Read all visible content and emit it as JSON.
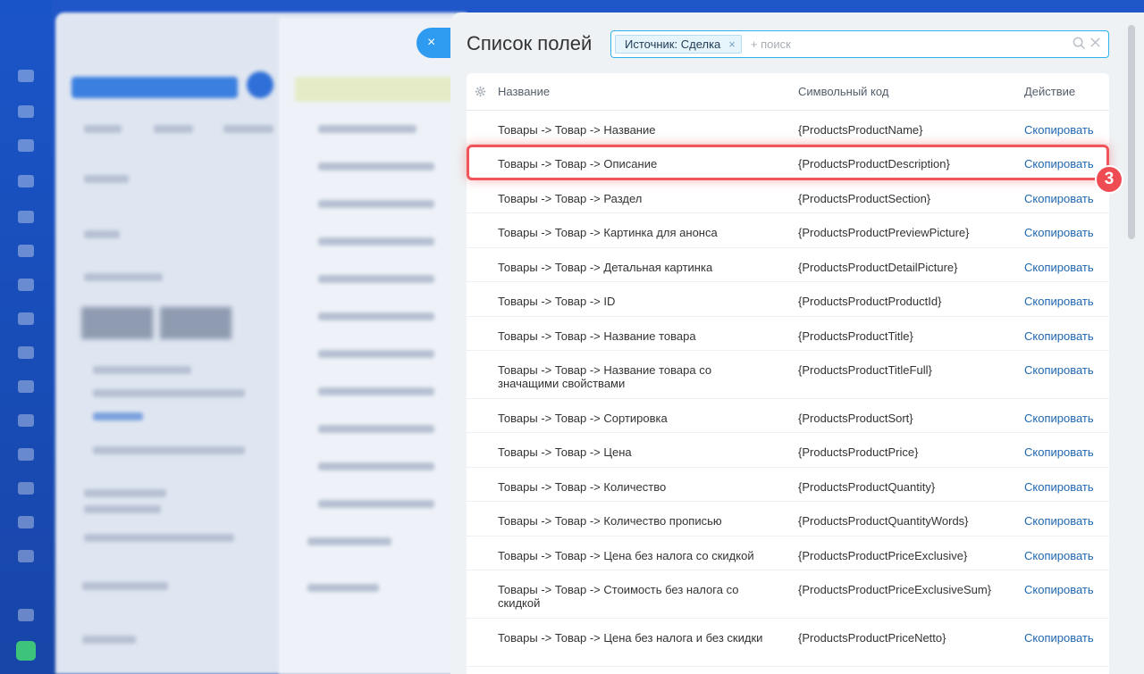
{
  "panel": {
    "title": "Список полей",
    "close_label": "×",
    "filter": {
      "chip_label": "Источник: Сделка",
      "chip_close": "×",
      "placeholder": "+ поиск",
      "search_icon": "🔍",
      "clear_icon": "✕"
    },
    "table": {
      "headers": {
        "name": "Название",
        "code": "Символьный код",
        "action": "Действие"
      },
      "settings_icon": "⚙",
      "rows": [
        {
          "name": "Товары -> Товар -> Название",
          "code": "{ProductsProductName}",
          "action": "Скопировать"
        },
        {
          "name": "Товары -> Товар -> Описание",
          "code": "{ProductsProductDescription}",
          "action": "Скопировать"
        },
        {
          "name": "Товары -> Товар -> Раздел",
          "code": "{ProductsProductSection}",
          "action": "Скопировать"
        },
        {
          "name": "Товары -> Товар -> Картинка для анонса",
          "code": "{ProductsProductPreviewPicture}",
          "action": "Скопировать"
        },
        {
          "name": "Товары -> Товар -> Детальная картинка",
          "code": "{ProductsProductDetailPicture}",
          "action": "Скопировать"
        },
        {
          "name": "Товары -> Товар -> ID",
          "code": "{ProductsProductProductId}",
          "action": "Скопировать"
        },
        {
          "name": "Товары -> Товар -> Название товара",
          "code": "{ProductsProductTitle}",
          "action": "Скопировать"
        },
        {
          "name": "Товары -> Товар -> Название товара со значащими свойствами",
          "code": "{ProductsProductTitleFull}",
          "action": "Скопировать"
        },
        {
          "name": "Товары -> Товар -> Сортировка",
          "code": "{ProductsProductSort}",
          "action": "Скопировать"
        },
        {
          "name": "Товары -> Товар -> Цена",
          "code": "{ProductsProductPrice}",
          "action": "Скопировать"
        },
        {
          "name": "Товары -> Товар -> Количество",
          "code": "{ProductsProductQuantity}",
          "action": "Скопировать"
        },
        {
          "name": "Товары -> Товар -> Количество прописью",
          "code": "{ProductsProductQuantityWords}",
          "action": "Скопировать"
        },
        {
          "name": "Товары -> Товар -> Цена без налога со скидкой",
          "code": "{ProductsProductPriceExclusive}",
          "action": "Скопировать"
        },
        {
          "name": "Товары -> Товар -> Стоимость без налога со скидкой",
          "code": "{ProductsProductPriceExclusiveSum}",
          "action": "Скопировать"
        },
        {
          "name": "Товары -> Товар -> Цена без налога и без скидки",
          "code": "{ProductsProductPriceNetto}",
          "action": "Скопировать"
        }
      ]
    }
  },
  "annotation": {
    "step_number": "3"
  },
  "colors": {
    "accent": "#2f9bf0",
    "link": "#2067b0",
    "highlight": "#f0555a"
  }
}
